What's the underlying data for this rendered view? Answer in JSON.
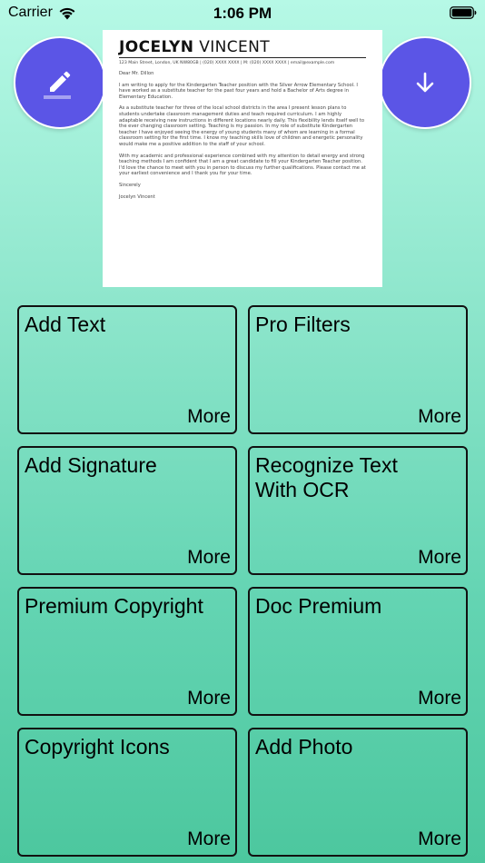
{
  "status_bar": {
    "carrier": "Carrier",
    "time": "1:06 PM"
  },
  "colors": {
    "accent": "#5b55e6",
    "background_top": "#b6f9e6",
    "background_bottom": "#4cc79e",
    "card_border": "#111111"
  },
  "top_actions": {
    "edit_icon": "pencil-icon",
    "download_icon": "arrow-down-icon"
  },
  "document": {
    "first_name": "JOCELYN",
    "last_name": "VINCENT",
    "contact": "123 Main Street, London, UK NW80GB  |  (020) XXXX XXXX  |  M: (020) XXXX XXXX  |  email@example.com",
    "greeting": "Dear Mr. Dillon",
    "paragraph_1": "I am writing to apply for the Kindergarten Teacher position with the Silver Arrow Elementary School. I have worked as a substitute teacher for the past four years and hold a Bachelor of Arts degree in Elementary Education.",
    "paragraph_2": "As a substitute teacher for three of the local school districts in the area I present lesson plans to students undertake classroom management duties and teach required curriculum. I am highly adaptable receiving new instructions in different locations nearly daily. This flexibility lends itself well to the ever changing classroom setting. Teaching is my passion. In my role of substitute Kindergarten teacher I have enjoyed seeing the energy of young students many of whom are learning in a formal classroom setting for the first time. I know my teaching skills love of children and energetic personality would make me a positive addition to the staff of your school.",
    "paragraph_3": "With my academic and professional experience combined with my attention to detail energy and strong teaching methods I am confident that I am a great candidate to fill your Kindergarten Teacher position. I'd love the chance to meet with you in person to discuss my further qualifications. Please contact me at your earliest convenience and I thank you for your time.",
    "closing": "Sincerely",
    "signature": "Jocelyn Vincent"
  },
  "features": [
    {
      "title": "Add Text",
      "more": "More"
    },
    {
      "title": "Pro Filters",
      "more": "More"
    },
    {
      "title": "Add Signature",
      "more": "More"
    },
    {
      "title": "Recognize Text With OCR",
      "more": "More"
    },
    {
      "title": "Premium Copyright",
      "more": "More"
    },
    {
      "title": "Doc Premium",
      "more": "More"
    },
    {
      "title": "Copyright Icons",
      "more": "More"
    },
    {
      "title": "Add Photo",
      "more": "More"
    }
  ]
}
